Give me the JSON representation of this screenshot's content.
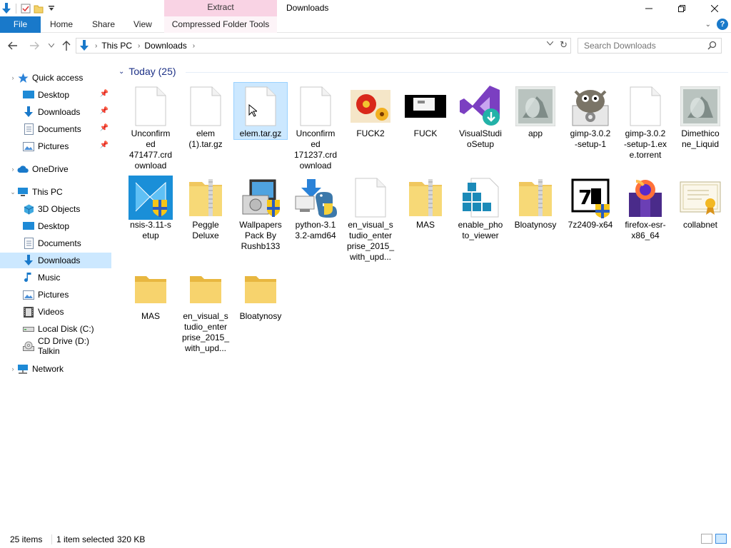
{
  "window": {
    "title": "Downloads",
    "context_tab_group": "Extract"
  },
  "ribbon": {
    "tabs": [
      "File",
      "Home",
      "Share",
      "View",
      "Compressed Folder Tools"
    ]
  },
  "address": {
    "segments": [
      "This PC",
      "Downloads"
    ]
  },
  "search": {
    "placeholder": "Search Downloads"
  },
  "sidebar": {
    "items": [
      {
        "label": "Quick access",
        "icon": "star-icon",
        "level": 0
      },
      {
        "label": "Desktop",
        "icon": "desktop-icon",
        "level": 1,
        "pinned": true
      },
      {
        "label": "Downloads",
        "icon": "download-arrow-icon",
        "level": 1,
        "pinned": true
      },
      {
        "label": "Documents",
        "icon": "documents-icon",
        "level": 1,
        "pinned": true
      },
      {
        "label": "Pictures",
        "icon": "pictures-icon",
        "level": 1,
        "pinned": true
      },
      {
        "label": "OneDrive",
        "icon": "cloud-icon",
        "level": 0
      },
      {
        "label": "This PC",
        "icon": "computer-icon",
        "level": 0
      },
      {
        "label": "3D Objects",
        "icon": "cube-icon",
        "level": 1
      },
      {
        "label": "Desktop",
        "icon": "desktop-icon",
        "level": 1
      },
      {
        "label": "Documents",
        "icon": "documents-icon",
        "level": 1
      },
      {
        "label": "Downloads",
        "icon": "download-arrow-icon",
        "level": 1,
        "selected": true
      },
      {
        "label": "Music",
        "icon": "music-icon",
        "level": 1
      },
      {
        "label": "Pictures",
        "icon": "pictures-icon",
        "level": 1
      },
      {
        "label": "Videos",
        "icon": "videos-icon",
        "level": 1
      },
      {
        "label": "Local Disk (C:)",
        "icon": "drive-icon",
        "level": 1
      },
      {
        "label": "CD Drive (D:) Talkin",
        "icon": "cd-drive-icon",
        "level": 1
      },
      {
        "label": "Network",
        "icon": "network-icon",
        "level": 0
      }
    ]
  },
  "content": {
    "group_header": "Today (25)",
    "files": [
      {
        "name": "Unconfirmed 471477.crdownload",
        "display": "Unconfirm\ned\n471477.crd\nownload",
        "icon": "blank-file-icon"
      },
      {
        "name": "elem (1).tar.gz",
        "display": "elem\n(1).tar.gz",
        "icon": "blank-file-icon"
      },
      {
        "name": "elem.tar.gz",
        "display": "elem.tar.gz",
        "icon": "blank-file-icon",
        "selected": true
      },
      {
        "name": "Unconfirmed 171237.crdownload",
        "display": "Unconfirm\ned\n171237.crd\nownload",
        "icon": "blank-file-icon"
      },
      {
        "name": "FUCK2",
        "display": "FUCK2",
        "icon": "flower-image-icon"
      },
      {
        "name": "FUCK",
        "display": "FUCK",
        "icon": "dark-image-icon"
      },
      {
        "name": "VisualStudioSetup",
        "display": "VisualStudi\noSetup",
        "icon": "visual-studio-installer-icon"
      },
      {
        "name": "app",
        "display": "app",
        "icon": "photo-thumbnail-icon"
      },
      {
        "name": "gimp-3.0.2-setup-1",
        "display": "gimp-3.0.2\n-setup-1",
        "icon": "gimp-installer-icon"
      },
      {
        "name": "gimp-3.0.2-setup-1.exe.torrent",
        "display": "gimp-3.0.2\n-setup-1.ex\ne.torrent",
        "icon": "blank-file-icon"
      },
      {
        "name": "Dimethicone_Liquid",
        "display": "Dimethico\nne_Liquid",
        "icon": "photo-thumbnail-icon"
      },
      {
        "name": "nsis-3.11-setup",
        "display": "nsis-3.11-s\netup",
        "icon": "nsis-installer-icon"
      },
      {
        "name": "Peggle Deluxe",
        "display": "Peggle\nDeluxe",
        "icon": "zip-folder-icon"
      },
      {
        "name": "Wallpapers Pack By Rushb133",
        "display": "Wallpapers\nPack By\nRushb133",
        "icon": "setup-installer-icon"
      },
      {
        "name": "python-3.13.2-amd64",
        "display": "python-3.1\n3.2-amd64",
        "icon": "python-installer-icon"
      },
      {
        "name": "en_visual_studio_enterprise_2015_with_upd...",
        "display": "en_visual_s\ntudio_enter\nprise_2015_\nwith_upd...",
        "icon": "blank-file-icon"
      },
      {
        "name": "MAS",
        "display": "MAS",
        "icon": "zip-folder-icon"
      },
      {
        "name": "enable_photo_viewer",
        "display": "enable_pho\nto_viewer",
        "icon": "registry-file-icon"
      },
      {
        "name": "Bloatynosy",
        "display": "Bloatynosy",
        "icon": "zip-folder-icon"
      },
      {
        "name": "7z2409-x64",
        "display": "7z2409-x64",
        "icon": "7zip-installer-icon"
      },
      {
        "name": "firefox-esr-x86_64",
        "display": "firefox-esr-\nx86_64",
        "icon": "firefox-installer-icon"
      },
      {
        "name": "collabnet",
        "display": "collabnet",
        "icon": "certificate-icon"
      },
      {
        "name": "MAS",
        "display": "MAS",
        "icon": "folder-icon"
      },
      {
        "name": "en_visual_studio_enterprise_2015_with_upd...",
        "display": "en_visual_s\ntudio_enter\nprise_2015_\nwith_upd...",
        "icon": "folder-icon"
      },
      {
        "name": "Bloatynosy",
        "display": "Bloatynosy",
        "icon": "folder-icon"
      }
    ]
  },
  "status": {
    "item_count": "25 items",
    "selection": "1 item selected",
    "size": "320 KB"
  },
  "colors": {
    "file_tab": "#1979ca",
    "context_tab": "#f9d3e4",
    "selection": "#cce8ff",
    "group_header": "#1e3287"
  }
}
